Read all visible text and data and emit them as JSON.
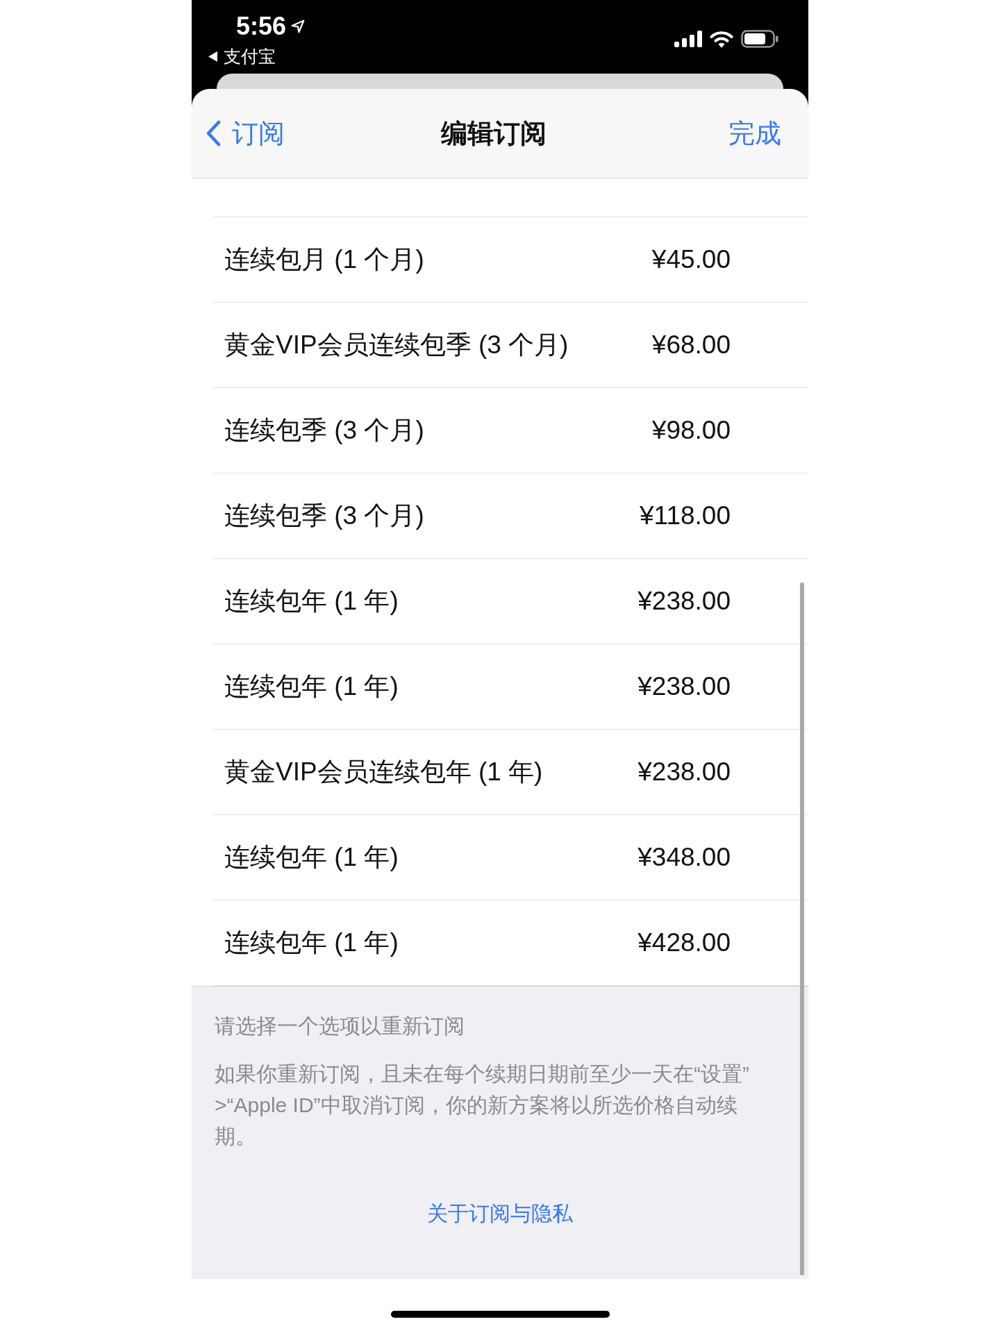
{
  "status_bar": {
    "time": "5:56",
    "back_app": "支付宝"
  },
  "nav": {
    "back_label": "订阅",
    "title": "编辑订阅",
    "done": "完成"
  },
  "options": [
    {
      "name": "连续包月 (1 个月)",
      "price": "¥45.00"
    },
    {
      "name": "黄金VIP会员连续包季 (3 个月)",
      "price": "¥68.00"
    },
    {
      "name": "连续包季 (3 个月)",
      "price": "¥98.00"
    },
    {
      "name": "连续包季 (3 个月)",
      "price": "¥118.00"
    },
    {
      "name": "连续包年 (1 年)",
      "price": "¥238.00"
    },
    {
      "name": "连续包年 (1 年)",
      "price": "¥238.00"
    },
    {
      "name": "黄金VIP会员连续包年 (1 年)",
      "price": "¥238.00"
    },
    {
      "name": "连续包年 (1 年)",
      "price": "¥348.00"
    },
    {
      "name": "连续包年 (1 年)",
      "price": "¥428.00"
    }
  ],
  "footer": {
    "heading": "请选择一个选项以重新订阅",
    "note": "如果你重新订阅，且未在每个续期日期前至少一天在“设置”>“Apple ID”中取消订阅，你的新方案将以所选价格自动续期。",
    "link": "关于订阅与隐私"
  }
}
